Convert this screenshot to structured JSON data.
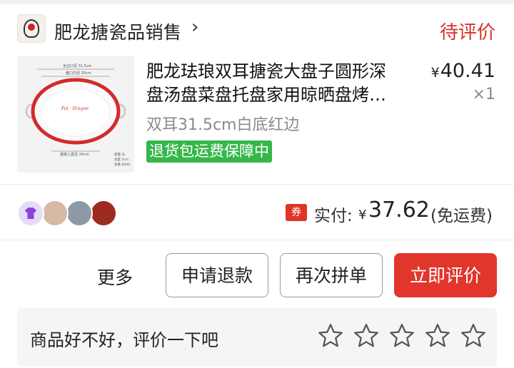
{
  "store": {
    "name": "肥龙搪瓷品销售",
    "arrow": "›",
    "status": "待评价"
  },
  "product": {
    "title_line1": "肥龙珐琅双耳搪瓷大盘子圆形深",
    "title_line2": "盘汤盘菜盘托盘家用晾晒盘烤…",
    "price_symbol": "¥",
    "price": "40.41",
    "quantity": "×1",
    "spec": "双耳31.5cm白底红边",
    "guarantee": "退货包运费保障中",
    "thumbnail_labels": {
      "outer_width": "全边口径 31.5cm",
      "inner_width": "盘口内径 30cm",
      "bottom_width": "盘底儿直径 24cm",
      "capacity": "容量 3L",
      "height": "高度 5cm",
      "weight": "净重 660G"
    }
  },
  "group": {
    "avatars": [
      "purple-shirt-avatar",
      "girl-avatar",
      "gray-avatar",
      "red-avatar"
    ],
    "coupon_label": "券",
    "paid_label": "实付:",
    "paid_symbol": "¥",
    "paid_amount": "37.62",
    "paid_note": "(免运费)"
  },
  "actions": {
    "more": "更多",
    "refund": "申请退款",
    "rebuy": "再次拼单",
    "review": "立即评价"
  },
  "rating": {
    "prompt": "商品好不好，评价一下吧",
    "stars_total": 5,
    "stars_filled": 0
  },
  "colors": {
    "accent_red": "#e0362c",
    "status_red": "#d8302a",
    "guarantee_green": "#35b74a"
  }
}
